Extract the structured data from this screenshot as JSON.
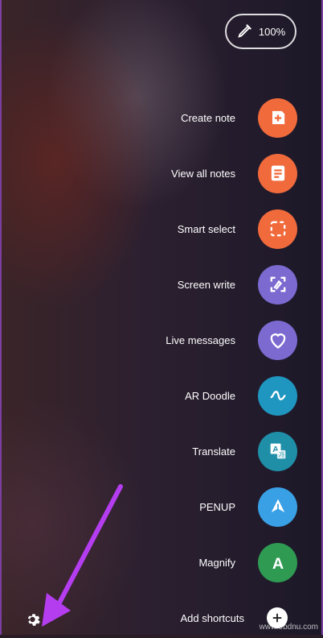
{
  "status": {
    "battery": "100%"
  },
  "menu": [
    {
      "label": "Create note",
      "icon": "create-note-icon",
      "color": "#f06a3c"
    },
    {
      "label": "View all notes",
      "icon": "view-notes-icon",
      "color": "#f06a3c"
    },
    {
      "label": "Smart select",
      "icon": "smart-select-icon",
      "color": "#f06a3c"
    },
    {
      "label": "Screen write",
      "icon": "screen-write-icon",
      "color": "#7c6ad0"
    },
    {
      "label": "Live messages",
      "icon": "live-messages-icon",
      "color": "#7c6ad0"
    },
    {
      "label": "AR Doodle",
      "icon": "ar-doodle-icon",
      "color": "#1f96c0"
    },
    {
      "label": "Translate",
      "icon": "translate-icon",
      "color": "#1f8fa8"
    },
    {
      "label": "PENUP",
      "icon": "penup-icon",
      "color": "#3aa0e6"
    },
    {
      "label": "Magnify",
      "icon": "magnify-icon",
      "color": "#2e9a52"
    }
  ],
  "add_shortcuts": {
    "label": "Add shortcuts"
  },
  "watermark": "www.9bdnu.com"
}
